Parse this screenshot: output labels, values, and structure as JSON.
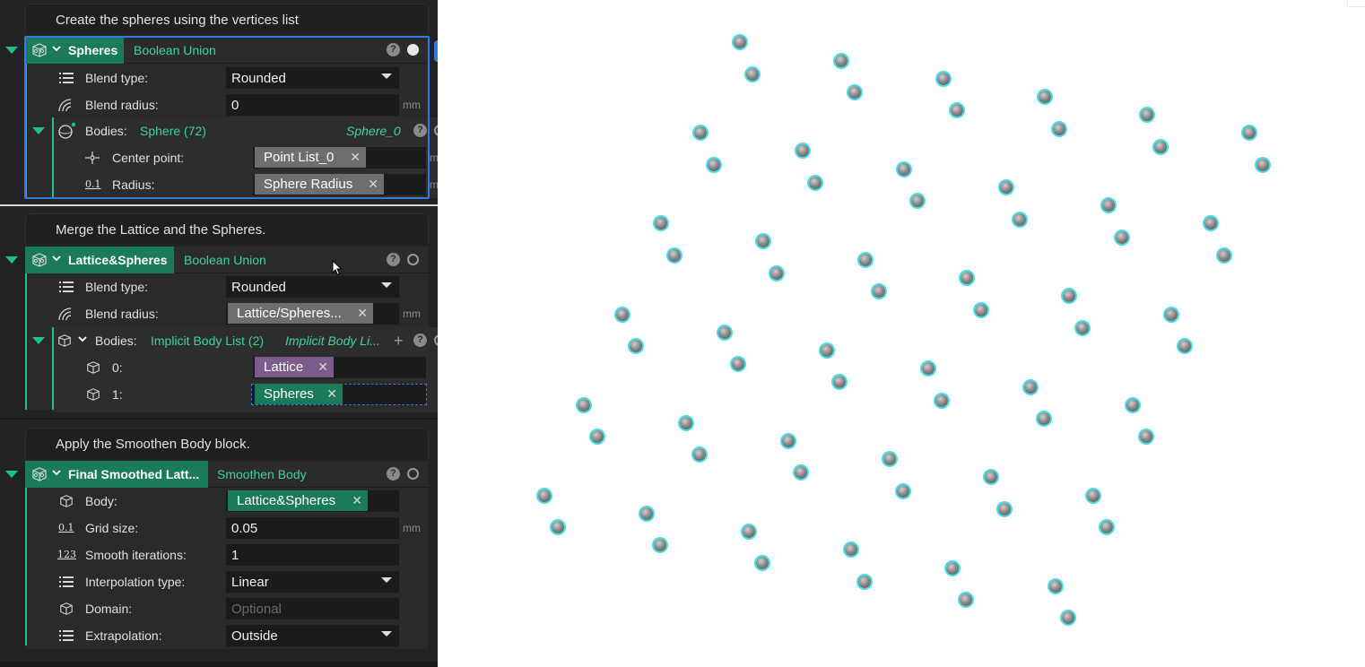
{
  "blocks": [
    {
      "comment": "Create the spheres using the vertices list",
      "name": "Spheres",
      "type": "Boolean Union",
      "blend_type_label": "Blend type:",
      "blend_type_value": "Rounded",
      "blend_radius_label": "Blend radius:",
      "blend_radius_value": "0",
      "unit": "mm",
      "bodies_label": "Bodies:",
      "bodies_value": "Sphere (72)",
      "bodies_italic": "Sphere_0",
      "center_label": "Center point:",
      "center_chip": "Point List_0",
      "radius_label": "Radius:",
      "radius_chip": "Sphere Radius"
    },
    {
      "comment": "Merge the Lattice and the Spheres.",
      "name": "Lattice&Spheres",
      "type": "Boolean Union",
      "blend_type_label": "Blend type:",
      "blend_type_value": "Rounded",
      "blend_radius_label": "Blend radius:",
      "blend_radius_chip": "Lattice/Spheres...",
      "unit": "mm",
      "bodies_label": "Bodies:",
      "bodies_value": "Implicit Body List (2)",
      "bodies_italic": "Implicit Body Li...",
      "item0_label": "0:",
      "item0_chip": "Lattice",
      "item1_label": "1:",
      "item1_chip": "Spheres"
    },
    {
      "comment": "Apply the Smoothen Body block.",
      "name": "Final Smoothed Latt...",
      "type": "Smoothen Body",
      "body_label": "Body:",
      "body_chip": "Lattice&Spheres",
      "grid_label": "Grid size:",
      "grid_value": "0.05",
      "unit": "mm",
      "iter_label": "Smooth iterations:",
      "iter_value": "1",
      "interp_label": "Interpolation type:",
      "interp_value": "Linear",
      "domain_label": "Domain:",
      "domain_placeholder": "Optional",
      "extrap_label": "Extrapolation:",
      "extrap_value": "Outside"
    }
  ],
  "icons": {
    "help": "?",
    "close": "✕",
    "add": "+"
  },
  "colors": {
    "accent_green": "#1c7a5c",
    "accent_teal_text": "#3ed3a0",
    "selection_blue": "#2f7be5",
    "sphere_outline": "#3fe0e8"
  },
  "viewport": {
    "sphere_count": 72,
    "spheres": [
      [
        825,
        47
      ],
      [
        839,
        83
      ],
      [
        938,
        68
      ],
      [
        953,
        103
      ],
      [
        1052,
        88
      ],
      [
        1067,
        123
      ],
      [
        1165,
        108
      ],
      [
        1181,
        144
      ],
      [
        1279,
        128
      ],
      [
        1294,
        164
      ],
      [
        1393,
        148
      ],
      [
        1408,
        184
      ],
      [
        781,
        148
      ],
      [
        796,
        184
      ],
      [
        895,
        168
      ],
      [
        909,
        204
      ],
      [
        1008,
        189
      ],
      [
        1023,
        224
      ],
      [
        1122,
        209
      ],
      [
        1137,
        245
      ],
      [
        1236,
        229
      ],
      [
        1251,
        265
      ],
      [
        1350,
        249
      ],
      [
        1365,
        285
      ],
      [
        737,
        249
      ],
      [
        752,
        285
      ],
      [
        851,
        269
      ],
      [
        866,
        305
      ],
      [
        965,
        290
      ],
      [
        980,
        325
      ],
      [
        1078,
        310
      ],
      [
        1094,
        346
      ],
      [
        1192,
        330
      ],
      [
        1207,
        366
      ],
      [
        1306,
        351
      ],
      [
        1321,
        386
      ],
      [
        694,
        351
      ],
      [
        709,
        386
      ],
      [
        808,
        371
      ],
      [
        823,
        406
      ],
      [
        922,
        391
      ],
      [
        936,
        426
      ],
      [
        1035,
        411
      ],
      [
        1050,
        447
      ],
      [
        1149,
        432
      ],
      [
        1164,
        467
      ],
      [
        1263,
        452
      ],
      [
        1278,
        487
      ],
      [
        651,
        452
      ],
      [
        666,
        487
      ],
      [
        765,
        472
      ],
      [
        780,
        507
      ],
      [
        879,
        492
      ],
      [
        893,
        527
      ],
      [
        992,
        512
      ],
      [
        1007,
        548
      ],
      [
        1105,
        532
      ],
      [
        1120,
        568
      ],
      [
        1219,
        553
      ],
      [
        1234,
        588
      ],
      [
        607,
        553
      ],
      [
        622,
        588
      ],
      [
        721,
        573
      ],
      [
        736,
        608
      ],
      [
        835,
        593
      ],
      [
        850,
        628
      ],
      [
        949,
        613
      ],
      [
        964,
        649
      ],
      [
        1062,
        634
      ],
      [
        1077,
        669
      ],
      [
        1177,
        654
      ],
      [
        1191,
        689
      ]
    ]
  }
}
